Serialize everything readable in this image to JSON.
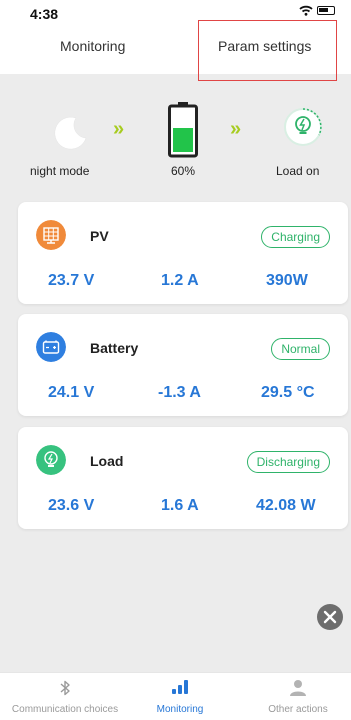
{
  "status": {
    "time": "4:38"
  },
  "tabs": {
    "monitoring": "Monitoring",
    "param_settings": "Param settings"
  },
  "flow": {
    "night_label": "night mode",
    "battery_percent_label": "60%",
    "battery_level": 0.6,
    "load_label": "Load on",
    "arrow_glyph": "»"
  },
  "cards": {
    "pv": {
      "title": "PV",
      "status": "Charging",
      "voltage": "23.7 V",
      "current": "1.2 A",
      "power": "390W"
    },
    "battery": {
      "title": "Battery",
      "status": "Normal",
      "voltage": "24.1 V",
      "current": "-1.3 A",
      "temperature": "29.5 °C"
    },
    "load": {
      "title": "Load",
      "status": "Discharging",
      "voltage": "23.6 V",
      "current": "1.6 A",
      "power": "42.08 W"
    }
  },
  "nav": {
    "communication": "Communication choices",
    "monitoring": "Monitoring",
    "other": "Other actions"
  },
  "colors": {
    "accent": "#2777d6",
    "status_green": "#2fb36a",
    "arrow_green": "#a7cc20",
    "pv_icon": "#f08a3a",
    "battery_icon": "#2f7fe0",
    "load_icon": "#37c27f"
  }
}
